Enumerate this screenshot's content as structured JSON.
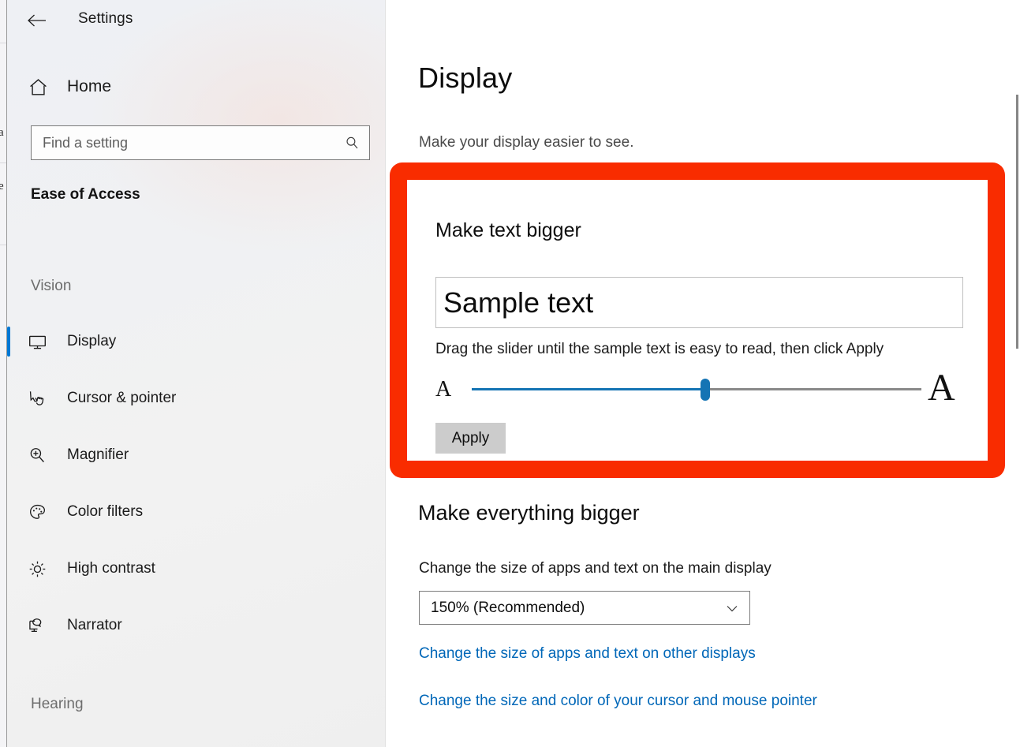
{
  "window": {
    "title": "Settings",
    "back_icon": "back-arrow-icon",
    "minimize_label": "—",
    "maximize_label": "□",
    "close_label": "✕"
  },
  "sidebar": {
    "home": {
      "label": "Home",
      "icon": "home-icon"
    },
    "search": {
      "value": "",
      "placeholder": "Find a setting",
      "icon": "search-icon"
    },
    "category_title": "Ease of Access",
    "groups": [
      {
        "label": "Vision"
      },
      {
        "label": "Hearing"
      }
    ],
    "items": [
      {
        "label": "Display",
        "icon": "monitor-icon",
        "selected": true
      },
      {
        "label": "Cursor & pointer",
        "icon": "cursor-pointer-icon",
        "selected": false
      },
      {
        "label": "Magnifier",
        "icon": "magnifier-icon",
        "selected": false
      },
      {
        "label": "Color filters",
        "icon": "palette-icon",
        "selected": false
      },
      {
        "label": "High contrast",
        "icon": "brightness-icon",
        "selected": false
      },
      {
        "label": "Narrator",
        "icon": "narrator-icon",
        "selected": false
      }
    ]
  },
  "main": {
    "title": "Display",
    "subtitle": "Make your display easier to see.",
    "text_section": {
      "heading": "Make text bigger",
      "sample_text": "Sample text",
      "hint": "Drag the slider until the sample text is easy to read, then click Apply",
      "slider": {
        "min_label": "A",
        "max_label": "A",
        "value_percent": 52
      },
      "apply_label": "Apply"
    },
    "scale_section": {
      "heading": "Make everything bigger",
      "label": "Change the size of apps and text on the main display",
      "selected_value": "150% (Recommended)",
      "chevron_icon": "chevron-down-icon",
      "options": [
        "150% (Recommended)"
      ]
    },
    "links": [
      {
        "label": "Change the size of apps and text on other displays"
      },
      {
        "label": "Change the size and color of your cursor and mouse pointer"
      }
    ]
  },
  "background_window": {
    "fragments": [
      "a",
      "e"
    ]
  },
  "colors": {
    "accent": "#0078d4",
    "highlight_border": "#f92c00",
    "link": "#0067b8",
    "slider_fill": "#1474b4",
    "apply_button_bg": "#cccccc"
  }
}
